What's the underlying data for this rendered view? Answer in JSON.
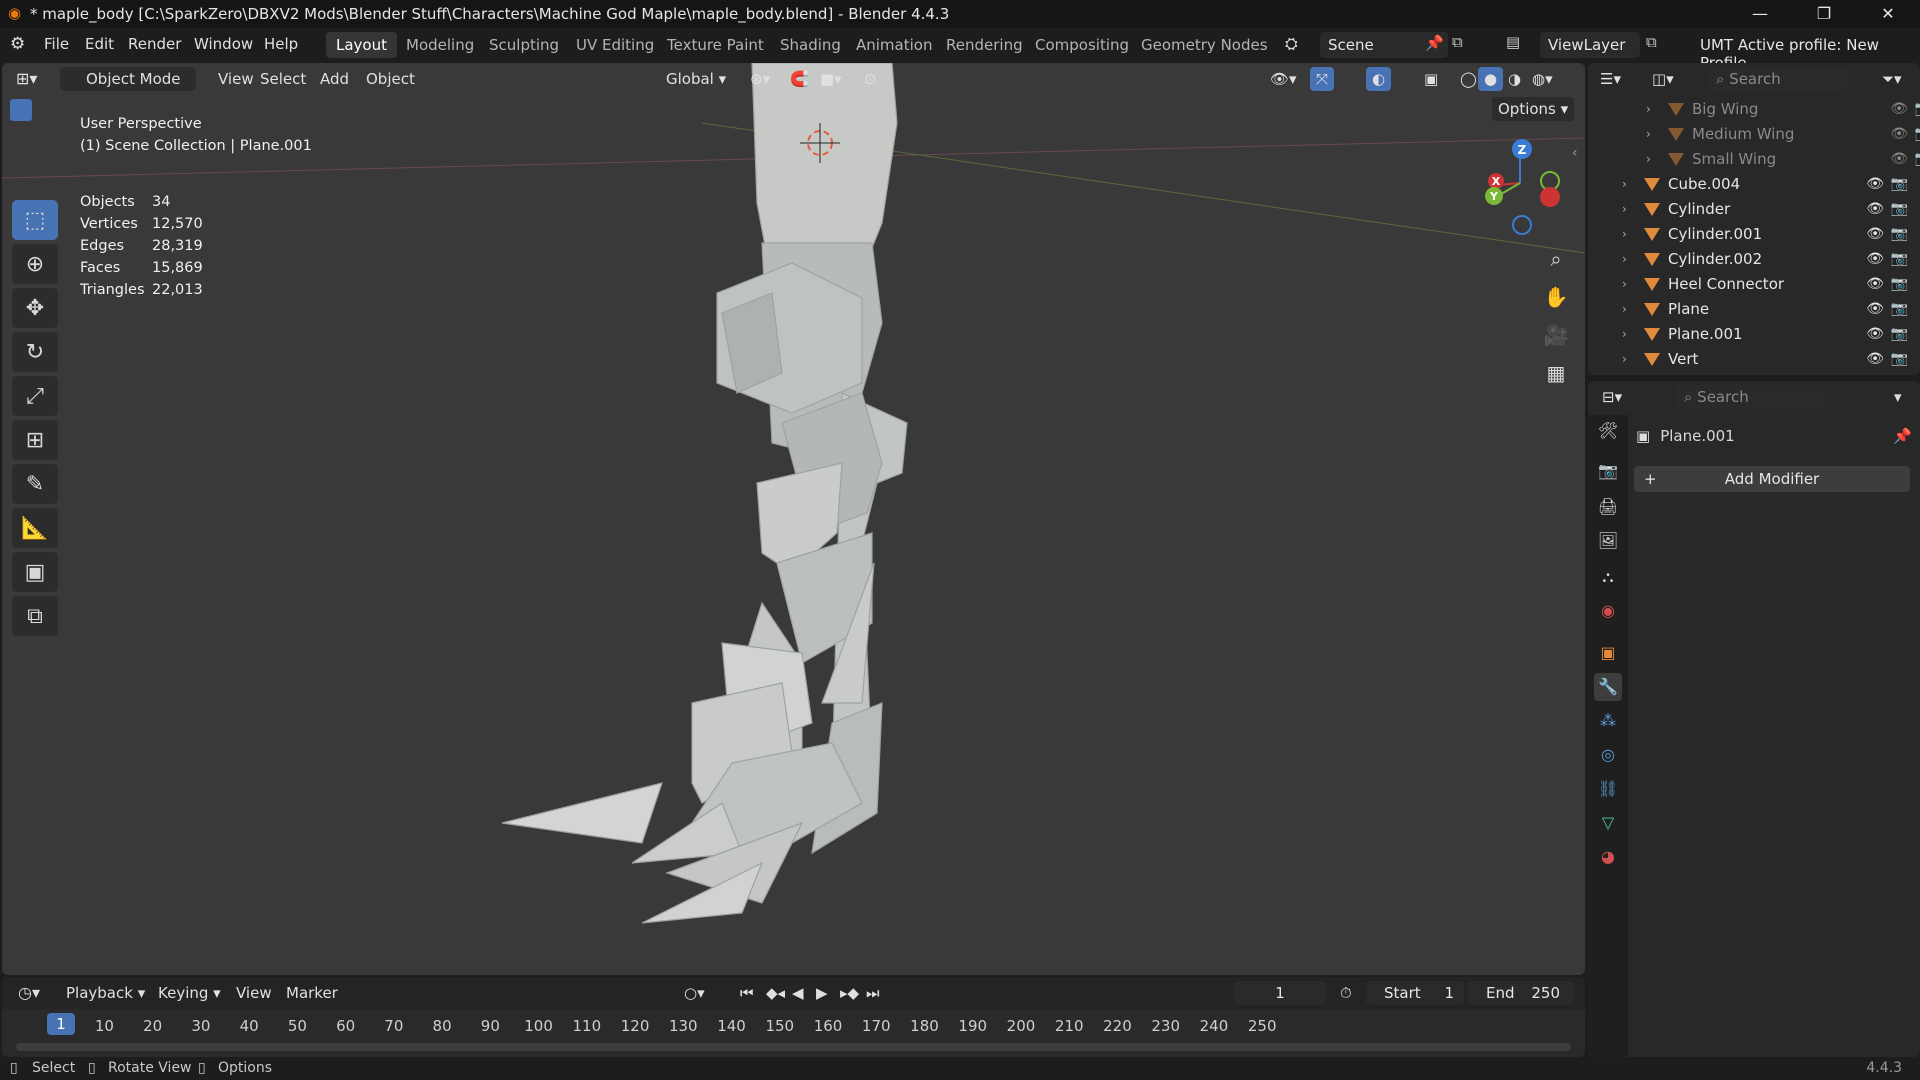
{
  "window": {
    "title": "* maple_body [C:\\SparkZero\\DBXV2 Mods\\Blender Stuff\\Characters\\Machine God Maple\\maple_body.blend] - Blender 4.4.3",
    "minimize": "—",
    "restore": "❐",
    "close": "✕"
  },
  "menu": {
    "file": "File",
    "edit": "Edit",
    "render": "Render",
    "window": "Window",
    "help": "Help"
  },
  "workspaces": [
    "Layout",
    "Modeling",
    "Sculpting",
    "UV Editing",
    "Texture Paint",
    "Shading",
    "Animation",
    "Rendering",
    "Compositing",
    "Geometry Nodes"
  ],
  "scene": {
    "name": "Scene",
    "viewlayer": "ViewLayer",
    "umt": "UMT Active profile: New Profile"
  },
  "viewport": {
    "mode": "Object Mode",
    "view": "View",
    "select": "Select",
    "add": "Add",
    "object": "Object",
    "transform": "Global",
    "options": "Options",
    "perspective": "User Perspective",
    "collection": "(1) Scene Collection | Plane.001",
    "stats": [
      {
        "k": "Objects",
        "v": "34"
      },
      {
        "k": "Vertices",
        "v": "12,570"
      },
      {
        "k": "Edges",
        "v": "28,319"
      },
      {
        "k": "Faces",
        "v": "15,869"
      },
      {
        "k": "Triangles",
        "v": "22,013"
      }
    ],
    "gizmo": {
      "x": "X",
      "y": "Y",
      "z": "Z"
    }
  },
  "tools": [
    "select-box-icon",
    "cursor-icon",
    "move-icon",
    "rotate-icon",
    "scale-icon",
    "transform-icon",
    "annotate-icon",
    "measure-icon",
    "add-cube-icon",
    "extrude-icon"
  ],
  "outliner": {
    "search": "Search",
    "items": [
      {
        "name": "Big Wing",
        "dim": true
      },
      {
        "name": "Medium Wing",
        "dim": true
      },
      {
        "name": "Small Wing",
        "dim": true
      },
      {
        "name": "Cube.004",
        "dim": false
      },
      {
        "name": "Cylinder",
        "dim": false
      },
      {
        "name": "Cylinder.001",
        "dim": false
      },
      {
        "name": "Cylinder.002",
        "dim": false
      },
      {
        "name": "Heel Connector",
        "dim": false
      },
      {
        "name": "Plane",
        "dim": false
      },
      {
        "name": "Plane.001",
        "dim": false
      },
      {
        "name": "Vert",
        "dim": false
      }
    ]
  },
  "properties": {
    "search": "Search",
    "object_name": "Plane.001",
    "add_modifier": "Add Modifier",
    "plus": "+"
  },
  "timeline": {
    "playback": "Playback",
    "keying": "Keying",
    "view": "View",
    "marker": "Marker",
    "current": "1",
    "start_label": "Start",
    "start": "1",
    "end_label": "End",
    "end": "250",
    "ticks": [
      "10",
      "20",
      "30",
      "40",
      "50",
      "60",
      "70",
      "80",
      "90",
      "100",
      "110",
      "120",
      "130",
      "140",
      "150",
      "160",
      "170",
      "180",
      "190",
      "200",
      "210",
      "220",
      "230",
      "240",
      "250"
    ],
    "current_tick": "1"
  },
  "statusbar": {
    "select": "Select",
    "rotate": "Rotate View",
    "options": "Options",
    "version": "4.4.3"
  },
  "colors": {
    "accent": "#4772b3",
    "mesh": "#c6c9c6",
    "object_icon": "#e08a3c",
    "viewport_bg": "#393939"
  }
}
